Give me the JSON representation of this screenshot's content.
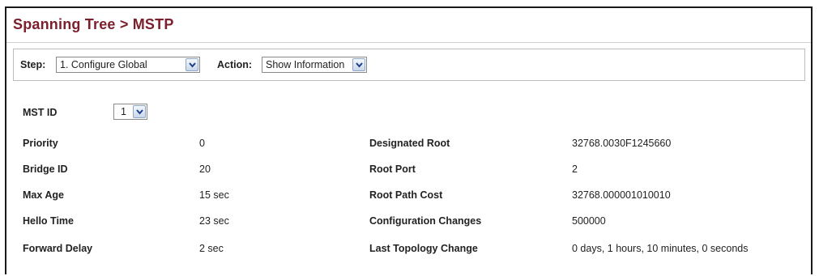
{
  "title": "Spanning Tree > MSTP",
  "step": {
    "label": "Step:",
    "value": "1. Configure Global"
  },
  "action": {
    "label": "Action:",
    "value": "Show Information"
  },
  "mst": {
    "label": "MST ID",
    "value": "1"
  },
  "left_rows": [
    {
      "label": "Priority",
      "value": "0"
    },
    {
      "label": "Bridge ID",
      "value": "20"
    },
    {
      "label": "Max Age",
      "value": "15 sec"
    },
    {
      "label": "Hello Time",
      "value": "23 sec"
    },
    {
      "label": "Forward Delay",
      "value": "2 sec"
    }
  ],
  "right_rows": [
    {
      "label": "Designated Root",
      "value": "32768.0030F1245660"
    },
    {
      "label": "Root Port",
      "value": "2"
    },
    {
      "label": "Root Path Cost",
      "value": "32768.000001010010"
    },
    {
      "label": "Configuration Changes",
      "value": "500000"
    },
    {
      "label": "Last Topology Change",
      "value": "0 days, 1 hours, 10 minutes, 0 seconds"
    }
  ],
  "colors": {
    "title": "#7a1f2b",
    "arrow_button": "#c9d7ea"
  },
  "icons": {
    "dropdown": "chevron-down-icon"
  }
}
